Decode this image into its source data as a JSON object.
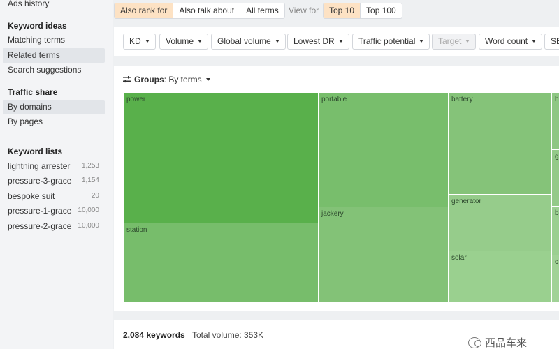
{
  "sidebar": {
    "ads_history": "Ads history",
    "keyword_ideas": {
      "heading": "Keyword ideas",
      "items": [
        "Matching terms",
        "Related terms",
        "Search suggestions"
      ],
      "active_index": 1
    },
    "traffic_share": {
      "heading": "Traffic share",
      "items": [
        "By domains",
        "By pages"
      ],
      "active_index": 0
    },
    "keyword_lists": {
      "heading": "Keyword lists",
      "items": [
        {
          "name": "lightning arrester",
          "count": "1,253"
        },
        {
          "name": "pressure-3-grace",
          "count": "1,154"
        },
        {
          "name": "bespoke suit",
          "count": "20"
        },
        {
          "name": "pressure-1-grace",
          "count": "10,000"
        },
        {
          "name": "pressure-2-grace",
          "count": "10,000"
        }
      ]
    }
  },
  "topbar": {
    "mode_options": [
      "Also rank for",
      "Also talk about",
      "All terms"
    ],
    "mode_selected": 0,
    "view_for_label": "View for",
    "view_options": [
      "Top 10",
      "Top 100"
    ],
    "view_selected": 0
  },
  "filters": {
    "buttons": [
      {
        "label": "KD",
        "enabled": true
      },
      {
        "label": "Volume",
        "enabled": true
      },
      {
        "label": "Global volume",
        "enabled": true
      },
      {
        "label": "Lowest DR",
        "enabled": true
      },
      {
        "label": "Traffic potential",
        "enabled": true
      },
      {
        "label": "Target",
        "enabled": false
      },
      {
        "label": "Word count",
        "enabled": true
      },
      {
        "label": "SE",
        "enabled": true
      }
    ]
  },
  "groups": {
    "label": "Groups",
    "value": "By terms",
    "icon": "sliders-icon"
  },
  "treemap": {
    "cells": [
      {
        "label": "power",
        "color": "#59b04b"
      },
      {
        "label": "station",
        "color": "#77bd6b"
      },
      {
        "label": "portable",
        "color": "#78be6c"
      },
      {
        "label": "jackery",
        "color": "#83c277"
      },
      {
        "label": "battery",
        "color": "#85c379"
      },
      {
        "label": "generator",
        "color": "#96cc8b"
      },
      {
        "label": "solar",
        "color": "#9ad08f"
      },
      {
        "label": "h",
        "color": "#8ec783"
      },
      {
        "label": "g",
        "color": "#94ca89"
      },
      {
        "label": "b",
        "color": "#9bcf91"
      },
      {
        "label": "c",
        "color": "#a1d297"
      }
    ]
  },
  "footer": {
    "keywords_count": "2,084 keywords",
    "total_volume": "Total volume: 353K",
    "watermark": "西品车来"
  }
}
